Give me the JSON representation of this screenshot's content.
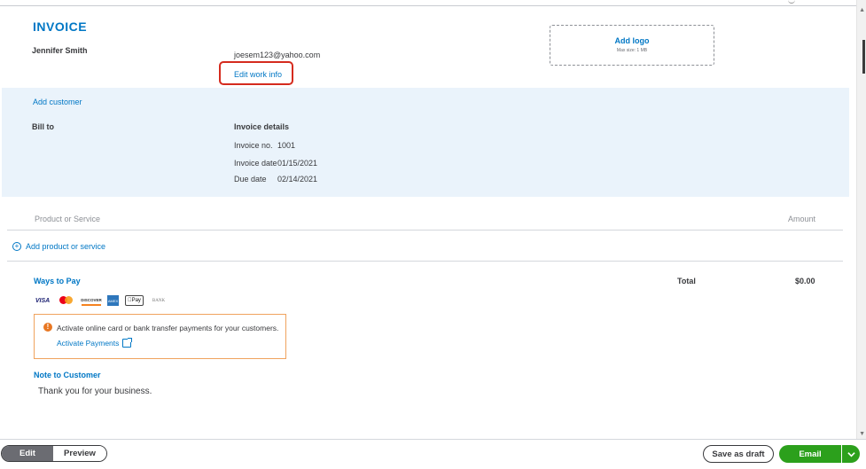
{
  "invoice": {
    "title": "INVOICE",
    "company_name": "Jennifer Smith",
    "company_email": "joesem123@yahoo.com",
    "edit_work_info": "Edit work info",
    "logo": {
      "label": "Add logo",
      "max_size": "Max size: 1 MB"
    }
  },
  "customer": {
    "add_customer": "Add customer",
    "bill_to": "Bill to"
  },
  "details": {
    "heading": "Invoice details",
    "invoice_no_label": "Invoice no.",
    "invoice_no": "1001",
    "invoice_date_label": "Invoice date",
    "invoice_date": "01/15/2021",
    "due_date_label": "Due date",
    "due_date": "02/14/2021"
  },
  "lines": {
    "col_product": "Product or Service",
    "col_amount": "Amount",
    "add_product": "Add product or service"
  },
  "payment": {
    "ways_to_pay": "Ways to Pay",
    "methods": [
      "VISA",
      "mastercard",
      "DISCOVER",
      "AMEX",
      "Pay",
      "BANK"
    ],
    "alert_text": "Activate online card or bank transfer payments for your customers.",
    "activate_link": "Activate Payments"
  },
  "totals": {
    "total_label": "Total",
    "total_value": "$0.00"
  },
  "note": {
    "label": "Note to Customer",
    "text": "Thank you for your business."
  },
  "footer": {
    "edit": "Edit",
    "preview": "Preview",
    "save_draft": "Save as draft",
    "email": "Email"
  },
  "colors": {
    "accent": "#0077c5",
    "primary_button": "#2ca01c",
    "panel": "#eaf3fb",
    "highlight": "#d52b1e"
  }
}
